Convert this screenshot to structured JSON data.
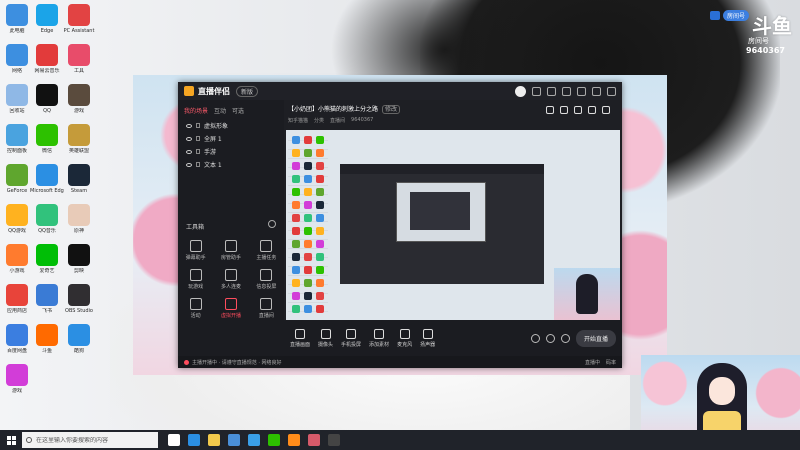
{
  "desktop": {
    "icons": [
      {
        "label": "此电脑",
        "color": "#3d8fe0"
      },
      {
        "label": "网络",
        "color": "#3d8fe0"
      },
      {
        "label": "回收站",
        "color": "#8fb8e6"
      },
      {
        "label": "控制面板",
        "color": "#4aa3df"
      },
      {
        "label": "GeForce",
        "color": "#5fa62e"
      },
      {
        "label": "QQ游戏",
        "color": "#ffb21f"
      },
      {
        "label": "小游戏",
        "color": "#ff7b2e"
      },
      {
        "label": "应用商店",
        "color": "#e8443a"
      },
      {
        "label": "百度网盘",
        "color": "#3b7ee0"
      },
      {
        "label": "游戏",
        "color": "#d23dd8"
      }
    ],
    "icons_col2": [
      {
        "label": "Edge",
        "color": "#1ba4e8"
      },
      {
        "label": "网易云音乐",
        "color": "#e23b3b"
      },
      {
        "label": "QQ",
        "color": "#111111"
      },
      {
        "label": "微信",
        "color": "#2dc100"
      },
      {
        "label": "Microsoft Edge",
        "color": "#2b8fe3"
      },
      {
        "label": "QQ音乐",
        "color": "#31c27c"
      },
      {
        "label": "爱奇艺",
        "color": "#00be06"
      },
      {
        "label": "飞书",
        "color": "#3a7bd5"
      },
      {
        "label": "斗鱼",
        "color": "#ff6a00"
      }
    ],
    "icons_col3": [
      {
        "label": "PC Assistant",
        "color": "#e24343"
      },
      {
        "label": "工具",
        "color": "#e84c6a"
      },
      {
        "label": "游戏",
        "color": "#5a4b3d"
      },
      {
        "label": "英雄联盟",
        "color": "#c59b3a"
      },
      {
        "label": "Steam",
        "color": "#1b2838"
      },
      {
        "label": "原神",
        "color": "#e8cbb8"
      },
      {
        "label": "剪映",
        "color": "#111111"
      },
      {
        "label": "OBS Studio",
        "color": "#302e31"
      },
      {
        "label": "酷狗",
        "color": "#2b8fe3"
      }
    ]
  },
  "app": {
    "brand": "直播伴侣",
    "version": "新版",
    "left_tabs": [
      "我的场景",
      "互动",
      "可选"
    ],
    "layers": [
      "虚拟形象",
      "全屏 1",
      "手游",
      "文本 1"
    ],
    "tools_heading": "工具箱",
    "tools": [
      {
        "label": "弹幕助手",
        "red": false
      },
      {
        "label": "房管助手",
        "red": false
      },
      {
        "label": "主播任务",
        "red": false
      },
      {
        "label": "玩游戏",
        "red": false
      },
      {
        "label": "多人连麦",
        "red": false
      },
      {
        "label": "信息投屏",
        "red": false
      },
      {
        "label": "活动",
        "red": false
      },
      {
        "label": "虚拟开播",
        "red": true
      },
      {
        "label": "直播间",
        "red": false
      }
    ],
    "stream_title": "【小奶团】小熊猫的刺激上分之路",
    "stream_badge": "修改",
    "stream_meta": [
      "知乎猫猫",
      "分类",
      "直播间",
      "9640367"
    ],
    "bottom_items": [
      "直播画面",
      "摄像头",
      "手机投屏",
      "添加素材",
      "麦克风",
      "扬声器"
    ],
    "start_button": "开始直播",
    "status_text": "主播开播中 · 请遵守直播规范 · 网络良好",
    "status_right": [
      "直播中",
      "码率"
    ]
  },
  "overlay": {
    "room_badge": "房间号",
    "logo_text": "斗鱼",
    "room_label": "房间号",
    "room_number": "9640367"
  },
  "taskbar": {
    "search_placeholder": "在这里输入你要搜索的内容",
    "apps": [
      {
        "name": "task-view",
        "color": "#ffffff"
      },
      {
        "name": "edge",
        "color": "#2b8fe3"
      },
      {
        "name": "explorer",
        "color": "#f2c94c"
      },
      {
        "name": "store",
        "color": "#4a90d9"
      },
      {
        "name": "app-blue",
        "color": "#3aa0e8"
      },
      {
        "name": "app-wechat",
        "color": "#2dc100"
      },
      {
        "name": "app-orange",
        "color": "#ff8c1a"
      },
      {
        "name": "app-live",
        "color": "#d65a6a"
      },
      {
        "name": "app-obs",
        "color": "#444444"
      }
    ]
  }
}
